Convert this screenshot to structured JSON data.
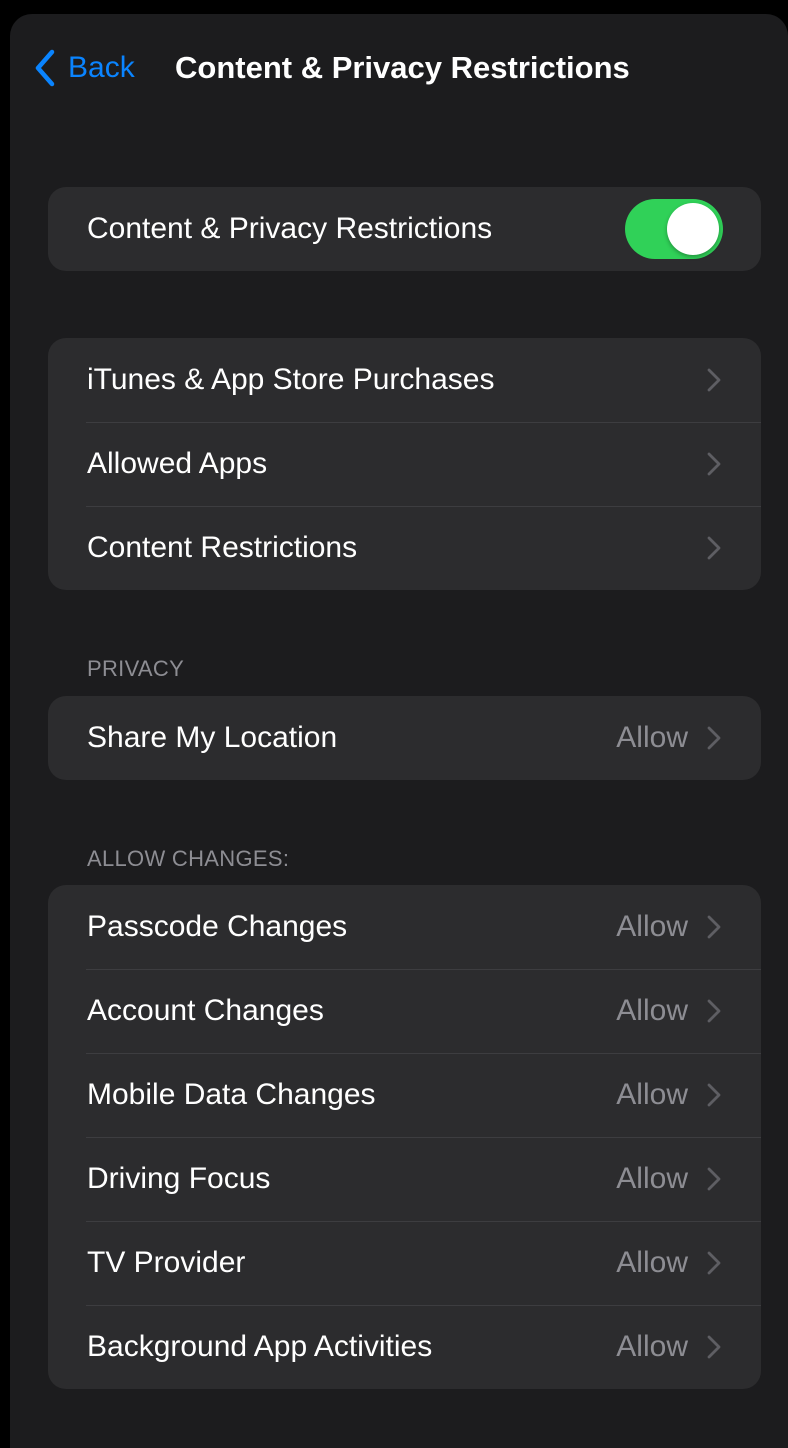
{
  "navbar": {
    "back_label": "Back",
    "title": "Content & Privacy Restrictions"
  },
  "master_toggle": {
    "label": "Content & Privacy Restrictions",
    "state": "on"
  },
  "store_group": {
    "items": [
      {
        "label": "iTunes & App Store Purchases"
      },
      {
        "label": "Allowed Apps"
      },
      {
        "label": "Content Restrictions"
      }
    ]
  },
  "privacy": {
    "header": "PRIVACY",
    "items": [
      {
        "label": "Share My Location",
        "value": "Allow"
      }
    ]
  },
  "allow_changes": {
    "header": "ALLOW CHANGES:",
    "items": [
      {
        "label": "Passcode Changes",
        "value": "Allow"
      },
      {
        "label": "Account Changes",
        "value": "Allow"
      },
      {
        "label": "Mobile Data Changes",
        "value": "Allow"
      },
      {
        "label": "Driving Focus",
        "value": "Allow"
      },
      {
        "label": "TV Provider",
        "value": "Allow"
      },
      {
        "label": "Background App Activities",
        "value": "Allow"
      }
    ]
  },
  "colors": {
    "accent": "#0a84ff",
    "toggle_on": "#30d158",
    "background": "#1c1c1e",
    "group_background": "#2c2c2e",
    "secondary_text": "#8d8d93"
  },
  "icons": {
    "back": "chevron-left-icon",
    "row": "chevron-right-icon"
  }
}
